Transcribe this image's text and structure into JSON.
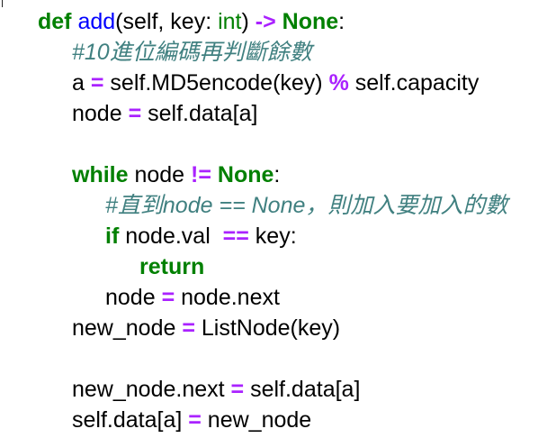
{
  "editor": {
    "colors": {
      "keyword": "#008000",
      "function_name": "#0000ff",
      "builtin": "#008000",
      "operator": "#aa22ff",
      "comment": "#408080",
      "text": "#000000",
      "background": "#ffffff"
    },
    "lines": [
      {
        "kw_def": "def",
        "fn_name": "add",
        "params_a": "(self, key: ",
        "type_int": "int",
        "params_b": ") ",
        "arrow": "->",
        "space": " ",
        "ret_none": "None",
        "colon": ":"
      },
      {
        "comment": "#10進位編碼再判斷餘數"
      },
      {
        "lhs": "a ",
        "eq": "=",
        "mid": " self.MD5encode(key) ",
        "mod": "%",
        "rhs": " self.capacity"
      },
      {
        "lhs": "node ",
        "eq": "=",
        "rhs": " self.data[a]"
      },
      {
        "kw_while": "while",
        "mid": " node ",
        "neq": "!=",
        "space": " ",
        "none": "None",
        "colon": ":"
      },
      {
        "comment": "#直到node == None，則加入要加入的數"
      },
      {
        "kw_if": "if",
        "mid": " node.val  ",
        "eqeq": "==",
        "rhs": " key:"
      },
      {
        "kw_return": "return"
      },
      {
        "lhs": "node ",
        "eq": "=",
        "rhs": " node.next"
      },
      {
        "lhs": "new_node ",
        "eq": "=",
        "rhs": " ListNode(key)"
      },
      {
        "lhs": "new_node.next ",
        "eq": "=",
        "rhs": " self.data[a]"
      },
      {
        "lhs": "self.data[a] ",
        "eq": "=",
        "rhs": " new_node"
      }
    ]
  }
}
